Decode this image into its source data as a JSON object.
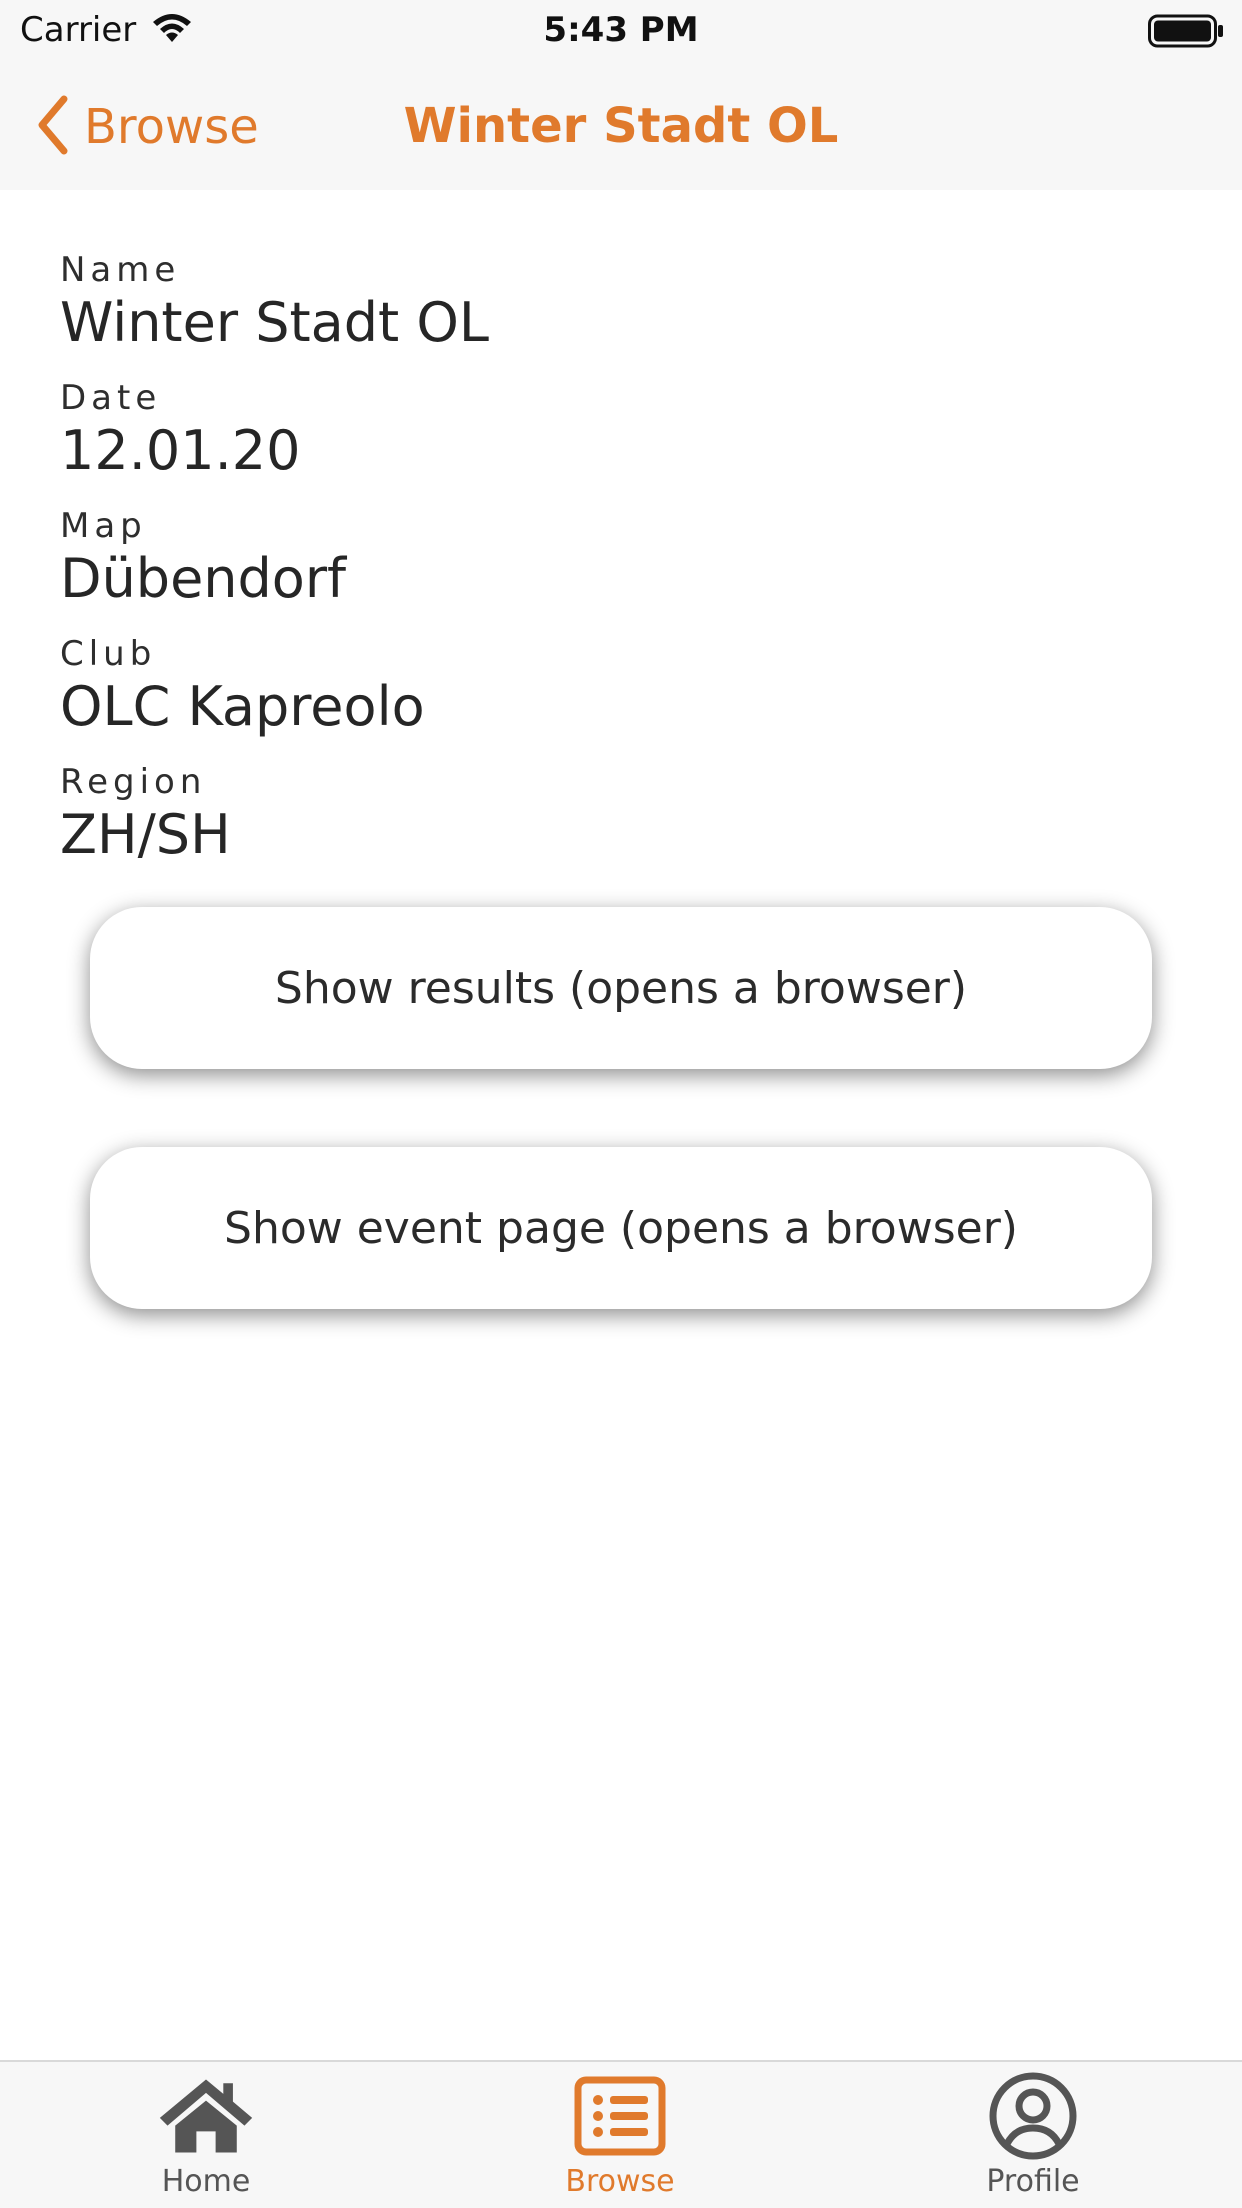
{
  "status_bar": {
    "carrier": "Carrier",
    "time": "5:43 PM",
    "wifi_icon": "wifi-icon",
    "battery_icon": "battery-icon"
  },
  "nav": {
    "back_label": "Browse",
    "title": "Winter Stadt OL",
    "accent_color": "#e07a2c"
  },
  "details": [
    {
      "label": "Name",
      "value": "Winter Stadt OL"
    },
    {
      "label": "Date",
      "value": "12.01.20"
    },
    {
      "label": "Map",
      "value": "Dübendorf"
    },
    {
      "label": "Club",
      "value": "OLC Kapreolo"
    },
    {
      "label": "Region",
      "value": "ZH/SH"
    }
  ],
  "buttons": {
    "results_label": "Show results (opens a browser)",
    "event_page_label": "Show event page (opens a browser)"
  },
  "tabs": [
    {
      "label": "Home",
      "icon": "home-icon",
      "selected": false
    },
    {
      "label": "Browse",
      "icon": "list-icon",
      "selected": true
    },
    {
      "label": "Profile",
      "icon": "profile-icon",
      "selected": false
    }
  ]
}
